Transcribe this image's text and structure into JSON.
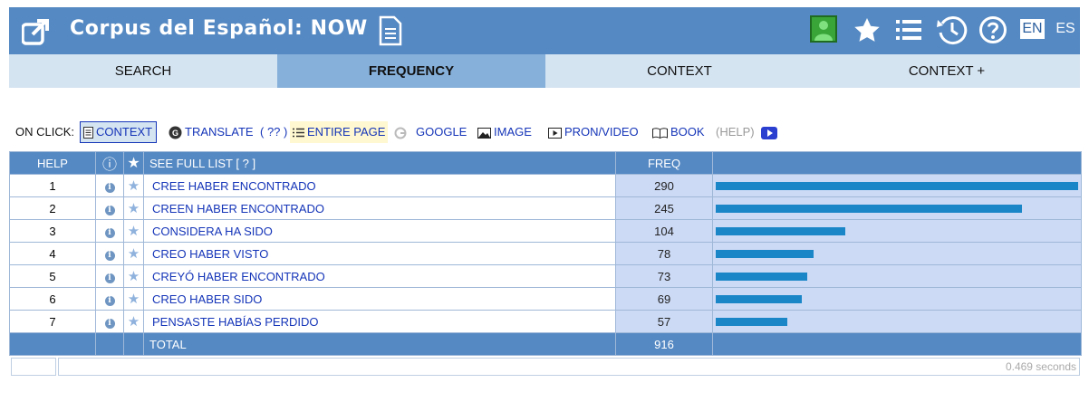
{
  "app": {
    "title": "Corpus del Español: NOW"
  },
  "header": {
    "lang_en": "EN",
    "lang_es": "ES"
  },
  "tabs": [
    {
      "label": "SEARCH"
    },
    {
      "label": "FREQUENCY"
    },
    {
      "label": "CONTEXT"
    },
    {
      "label": "CONTEXT +"
    }
  ],
  "on_click": {
    "label": "ON CLICK:",
    "context": "CONTEXT",
    "translate": "TRANSLATE",
    "translate_help": "( ?? )",
    "entire_page": "ENTIRE PAGE",
    "google": "GOOGLE",
    "image": "IMAGE",
    "pron_video": "PRON/VIDEO",
    "book": "BOOK",
    "help": "(HELP)"
  },
  "table": {
    "headers": {
      "help": "HELP",
      "info": "ⓘ",
      "star": "★",
      "word": "SEE FULL LIST  [ ? ]",
      "freq": "FREQ"
    },
    "max_freq": 290,
    "rows": [
      {
        "num": "1",
        "word": "CREE HABER ENCONTRADO",
        "freq": 290
      },
      {
        "num": "2",
        "word": "CREEN HABER ENCONTRADO",
        "freq": 245
      },
      {
        "num": "3",
        "word": "CONSIDERA HA SIDO",
        "freq": 104
      },
      {
        "num": "4",
        "word": "CREO HABER VISTO",
        "freq": 78
      },
      {
        "num": "5",
        "word": "CREYÓ HABER ENCONTRADO",
        "freq": 73
      },
      {
        "num": "6",
        "word": "CREO HABER SIDO",
        "freq": 69
      },
      {
        "num": "7",
        "word": "PENSASTE HABÍAS PERDIDO",
        "freq": 57
      }
    ],
    "total_label": "TOTAL",
    "total": "916"
  },
  "status": {
    "seconds": "0.469 seconds"
  },
  "colors": {
    "header": "#5589c3",
    "tab_active": "#86b0da",
    "bar": "#1a86c8",
    "link": "#1535b8"
  }
}
